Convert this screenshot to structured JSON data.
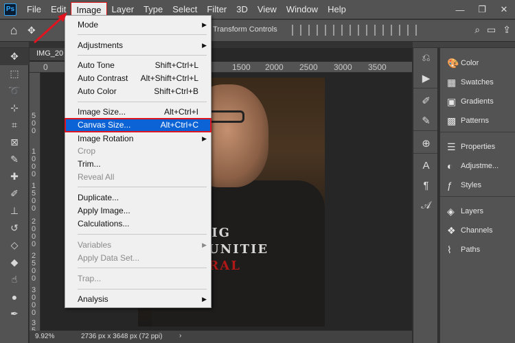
{
  "app": {
    "logo": "Ps"
  },
  "menubar": {
    "items": [
      "File",
      "Edit",
      "Image",
      "Layer",
      "Type",
      "Select",
      "Filter",
      "3D",
      "View",
      "Window",
      "Help"
    ],
    "active": "Image"
  },
  "window_controls": {
    "minimize": "—",
    "restore": "❐",
    "close": "✕"
  },
  "options_bar": {
    "transform_label": "Transform Controls"
  },
  "document": {
    "tab_title": "IMG_20",
    "zoom": "9.92%",
    "dimensions": "2736 px x 3648 px (72 ppi)",
    "status_chevron": "›"
  },
  "ruler_h": [
    "0",
    "1500",
    "2000",
    "2500",
    "3000",
    "3500"
  ],
  "ruler_v": [
    "5 0 0",
    "1 0 0 0",
    "1 5 0 0",
    "2 0 0 0",
    "2 5 0 0",
    "3 0 0 0",
    "3 5 0 0"
  ],
  "shirt_text": [
    "BIG",
    "RTUNITIE",
    "IMRAL"
  ],
  "image_menu": {
    "items": [
      {
        "label": "Mode",
        "shortcut": "",
        "submenu": true,
        "disabled": false
      },
      {
        "label": "Adjustments",
        "shortcut": "",
        "submenu": true,
        "disabled": false
      },
      {
        "label": "Auto Tone",
        "shortcut": "Shift+Ctrl+L",
        "submenu": false,
        "disabled": false
      },
      {
        "label": "Auto Contrast",
        "shortcut": "Alt+Shift+Ctrl+L",
        "submenu": false,
        "disabled": false
      },
      {
        "label": "Auto Color",
        "shortcut": "Shift+Ctrl+B",
        "submenu": false,
        "disabled": false
      },
      {
        "label": "Image Size...",
        "shortcut": "Alt+Ctrl+I",
        "submenu": false,
        "disabled": false
      },
      {
        "label": "Canvas Size...",
        "shortcut": "Alt+Ctrl+C",
        "submenu": false,
        "disabled": false,
        "highlighted": true
      },
      {
        "label": "Image Rotation",
        "shortcut": "",
        "submenu": true,
        "disabled": false
      },
      {
        "label": "Crop",
        "shortcut": "",
        "submenu": false,
        "disabled": true
      },
      {
        "label": "Trim...",
        "shortcut": "",
        "submenu": false,
        "disabled": false
      },
      {
        "label": "Reveal All",
        "shortcut": "",
        "submenu": false,
        "disabled": true
      },
      {
        "label": "Duplicate...",
        "shortcut": "",
        "submenu": false,
        "disabled": false
      },
      {
        "label": "Apply Image...",
        "shortcut": "",
        "submenu": false,
        "disabled": false
      },
      {
        "label": "Calculations...",
        "shortcut": "",
        "submenu": false,
        "disabled": false
      },
      {
        "label": "Variables",
        "shortcut": "",
        "submenu": true,
        "disabled": true
      },
      {
        "label": "Apply Data Set...",
        "shortcut": "",
        "submenu": false,
        "disabled": true
      },
      {
        "label": "Trap...",
        "shortcut": "",
        "submenu": false,
        "disabled": true
      },
      {
        "label": "Analysis",
        "shortcut": "",
        "submenu": true,
        "disabled": false
      }
    ]
  },
  "right_panels": {
    "group1": [
      {
        "label": "Color",
        "icon": "palette-icon"
      },
      {
        "label": "Swatches",
        "icon": "grid-icon"
      },
      {
        "label": "Gradients",
        "icon": "gradient-icon"
      },
      {
        "label": "Patterns",
        "icon": "pattern-icon"
      }
    ],
    "group2": [
      {
        "label": "Properties",
        "icon": "properties-icon"
      },
      {
        "label": "Adjustme...",
        "icon": "adjustments-icon"
      },
      {
        "label": "Styles",
        "icon": "fx-icon"
      }
    ],
    "group3": [
      {
        "label": "Layers",
        "icon": "layers-icon"
      },
      {
        "label": "Channels",
        "icon": "channels-icon"
      },
      {
        "label": "Paths",
        "icon": "paths-icon"
      }
    ]
  },
  "colors": {
    "highlight": "#0c63d6",
    "annotation_red": "#e0141e",
    "panel_bg": "#535353"
  }
}
